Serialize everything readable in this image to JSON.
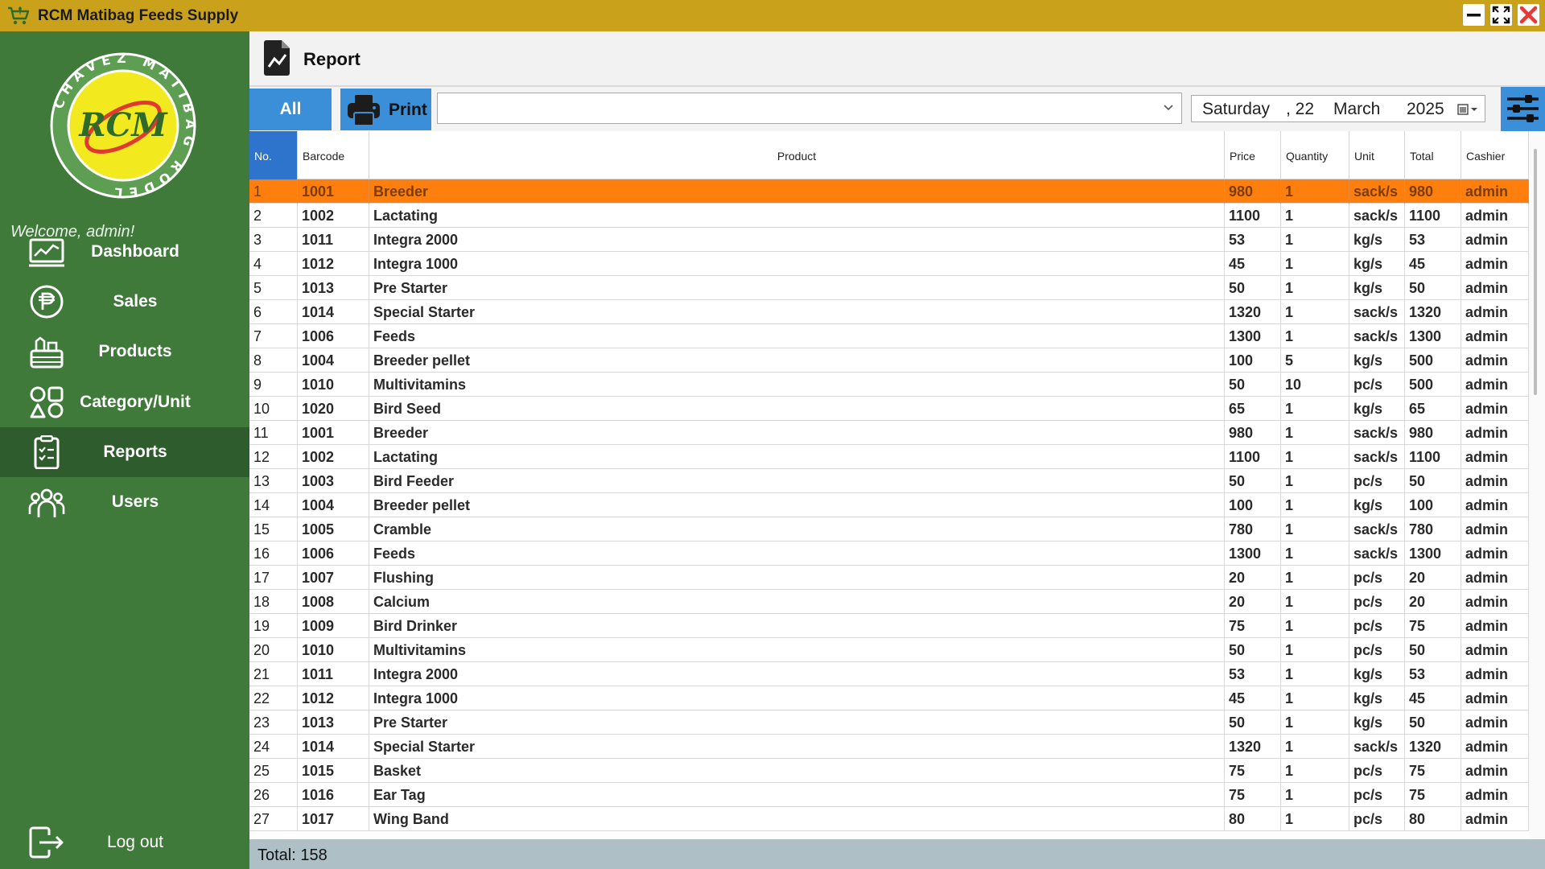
{
  "window": {
    "title": "RCM Matibag Feeds Supply",
    "accent_titlebar": "#CAA11A",
    "close_color": "#E53935"
  },
  "sidebar": {
    "logo": {
      "center_text": "RCM",
      "ring_text": "CHAVEZ MATIBAG RODEL"
    },
    "welcome": "Welcome, admin!",
    "items": [
      {
        "label": "Dashboard",
        "icon": "chart-monitor-icon"
      },
      {
        "label": "Sales",
        "icon": "peso-coin-icon"
      },
      {
        "label": "Products",
        "icon": "products-basket-icon"
      },
      {
        "label": "Category/Unit",
        "icon": "shapes-icon"
      },
      {
        "label": "Reports",
        "icon": "clipboard-report-icon",
        "active": true
      },
      {
        "label": "Users",
        "icon": "users-group-icon"
      }
    ],
    "logout_label": "Log out",
    "colors": {
      "bg": "#3F7A3A",
      "active": "#2F5C2C"
    }
  },
  "header": {
    "title": "Report"
  },
  "toolbar": {
    "all_label": "All",
    "print_label": "Print",
    "filter_value": "",
    "date": {
      "day": "Saturday",
      "num": ", 22",
      "month": "March",
      "year": "2025"
    }
  },
  "table": {
    "columns": [
      "No.",
      "Barcode",
      "Product",
      "Price",
      "Quantity",
      "Unit",
      "Total",
      "Cashier"
    ],
    "rows": [
      [
        "1",
        "1001",
        "Breeder",
        "980",
        "1",
        "sack/s",
        "980",
        "admin"
      ],
      [
        "2",
        "1002",
        "Lactating",
        "1100",
        "1",
        "sack/s",
        "1100",
        "admin"
      ],
      [
        "3",
        "1011",
        "Integra 2000",
        "53",
        "1",
        "kg/s",
        "53",
        "admin"
      ],
      [
        "4",
        "1012",
        "Integra 1000",
        "45",
        "1",
        "kg/s",
        "45",
        "admin"
      ],
      [
        "5",
        "1013",
        "Pre Starter",
        "50",
        "1",
        "kg/s",
        "50",
        "admin"
      ],
      [
        "6",
        "1014",
        "Special Starter",
        "1320",
        "1",
        "sack/s",
        "1320",
        "admin"
      ],
      [
        "7",
        "1006",
        "Feeds",
        "1300",
        "1",
        "sack/s",
        "1300",
        "admin"
      ],
      [
        "8",
        "1004",
        "Breeder pellet",
        "100",
        "5",
        "kg/s",
        "500",
        "admin"
      ],
      [
        "9",
        "1010",
        "Multivitamins",
        "50",
        "10",
        "pc/s",
        "500",
        "admin"
      ],
      [
        "10",
        "1020",
        "Bird Seed",
        "65",
        "1",
        "kg/s",
        "65",
        "admin"
      ],
      [
        "11",
        "1001",
        "Breeder",
        "980",
        "1",
        "sack/s",
        "980",
        "admin"
      ],
      [
        "12",
        "1002",
        "Lactating",
        "1100",
        "1",
        "sack/s",
        "1100",
        "admin"
      ],
      [
        "13",
        "1003",
        "Bird Feeder",
        "50",
        "1",
        "pc/s",
        "50",
        "admin"
      ],
      [
        "14",
        "1004",
        "Breeder pellet",
        "100",
        "1",
        "kg/s",
        "100",
        "admin"
      ],
      [
        "15",
        "1005",
        "Cramble",
        "780",
        "1",
        "sack/s",
        "780",
        "admin"
      ],
      [
        "16",
        "1006",
        "Feeds",
        "1300",
        "1",
        "sack/s",
        "1300",
        "admin"
      ],
      [
        "17",
        "1007",
        "Flushing",
        "20",
        "1",
        "pc/s",
        "20",
        "admin"
      ],
      [
        "18",
        "1008",
        "Calcium",
        "20",
        "1",
        "pc/s",
        "20",
        "admin"
      ],
      [
        "19",
        "1009",
        "Bird Drinker",
        "75",
        "1",
        "pc/s",
        "75",
        "admin"
      ],
      [
        "20",
        "1010",
        "Multivitamins",
        "50",
        "1",
        "pc/s",
        "50",
        "admin"
      ],
      [
        "21",
        "1011",
        "Integra 2000",
        "53",
        "1",
        "kg/s",
        "53",
        "admin"
      ],
      [
        "22",
        "1012",
        "Integra 1000",
        "45",
        "1",
        "kg/s",
        "45",
        "admin"
      ],
      [
        "23",
        "1013",
        "Pre Starter",
        "50",
        "1",
        "kg/s",
        "50",
        "admin"
      ],
      [
        "24",
        "1014",
        "Special Starter",
        "1320",
        "1",
        "sack/s",
        "1320",
        "admin"
      ],
      [
        "25",
        "1015",
        "Basket",
        "75",
        "1",
        "pc/s",
        "75",
        "admin"
      ],
      [
        "26",
        "1016",
        "Ear Tag",
        "75",
        "1",
        "pc/s",
        "75",
        "admin"
      ],
      [
        "27",
        "1017",
        "Wing Band",
        "80",
        "1",
        "pc/s",
        "80",
        "admin"
      ]
    ],
    "selected_row": 0,
    "colors": {
      "selected": "#FF7F0E",
      "header_first": "#2E74CC"
    }
  },
  "footer": {
    "total": "Total: 158"
  }
}
